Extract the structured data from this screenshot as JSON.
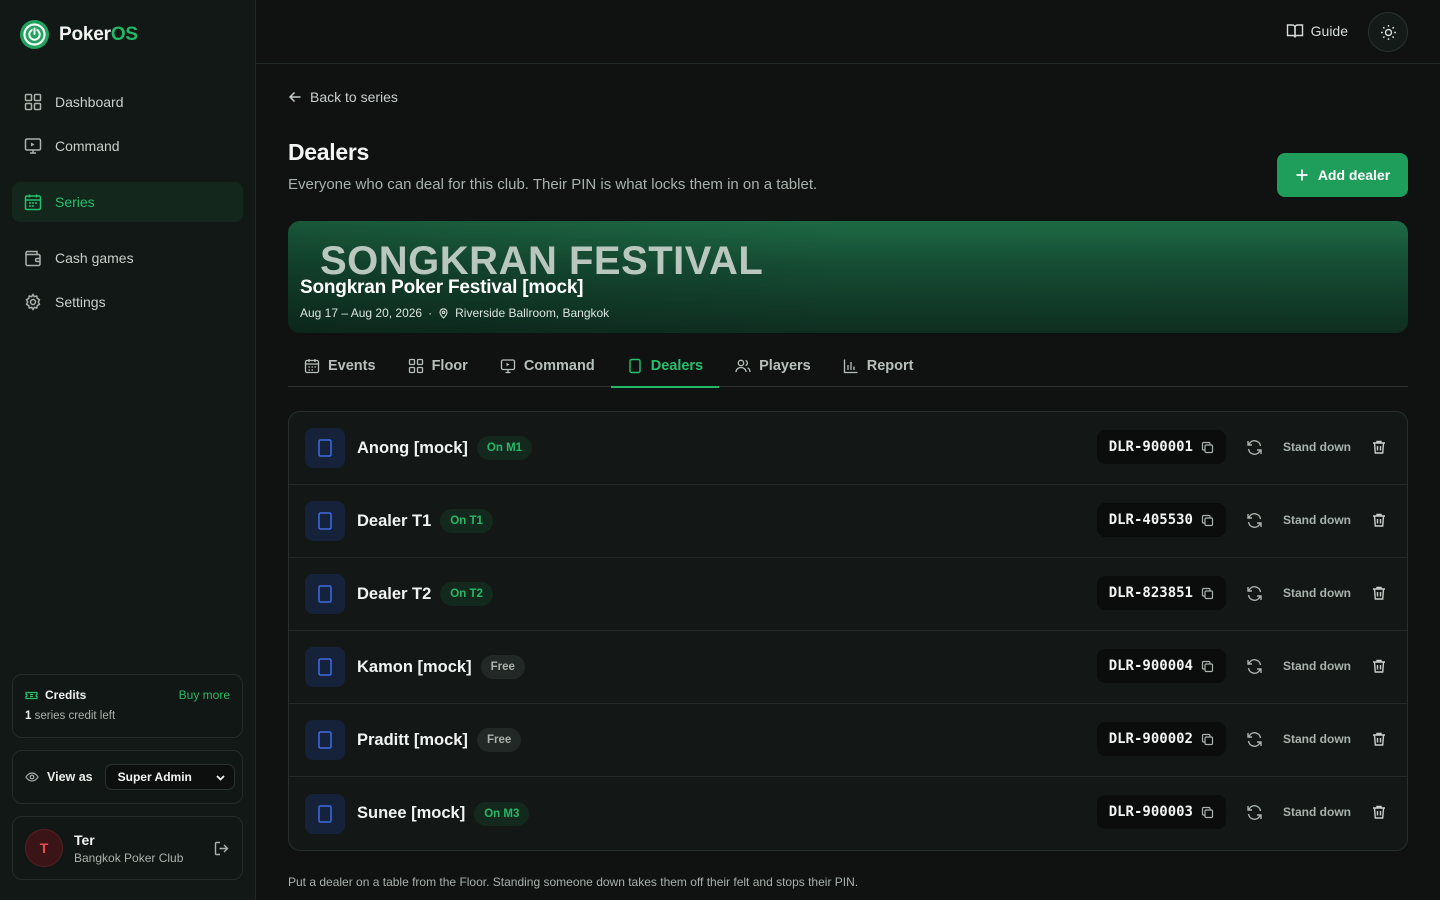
{
  "app": {
    "logo_main": "Poker",
    "logo_accent": "OS"
  },
  "sidebar": {
    "items": [
      {
        "label": "Dashboard",
        "icon": "grid-icon"
      },
      {
        "label": "Command",
        "icon": "monitor-icon"
      },
      {
        "label": "Series",
        "icon": "calendar-icon"
      },
      {
        "label": "Cash games",
        "icon": "wallet-icon"
      },
      {
        "label": "Settings",
        "icon": "gear-icon"
      }
    ],
    "active": "Series",
    "credits": {
      "title": "Credits",
      "buy_more": "Buy more",
      "count": "1",
      "suffix": "series credit left"
    },
    "view_as": {
      "label": "View as",
      "value": "Super Admin"
    },
    "user": {
      "initial": "T",
      "name": "Ter",
      "club": "Bangkok Poker Club"
    }
  },
  "topbar": {
    "guide": "Guide"
  },
  "page": {
    "back": "Back to series",
    "title": "Dealers",
    "subtitle": "Everyone who can deal for this club. Their PIN is what locks them in on a tablet.",
    "add_button": "Add dealer"
  },
  "banner": {
    "big_text": "SONGKRAN FESTIVAL",
    "name": "Songkran Poker Festival [mock]",
    "dates": "Aug 17 – Aug 20, 2026",
    "separator": "·",
    "venue": "Riverside Ballroom, Bangkok"
  },
  "tabs": [
    {
      "label": "Events",
      "icon": "calendar-icon"
    },
    {
      "label": "Floor",
      "icon": "grid-icon"
    },
    {
      "label": "Command",
      "icon": "monitor-icon"
    },
    {
      "label": "Dealers",
      "icon": "tablet-icon"
    },
    {
      "label": "Players",
      "icon": "users-icon"
    },
    {
      "label": "Report",
      "icon": "bar-chart-icon"
    }
  ],
  "active_tab": "Dealers",
  "dealers": [
    {
      "name": "Anong [mock]",
      "status": "On M1",
      "state": "on",
      "pin": "DLR-900001",
      "action": "Stand down"
    },
    {
      "name": "Dealer T1",
      "status": "On T1",
      "state": "on",
      "pin": "DLR-405530",
      "action": "Stand down"
    },
    {
      "name": "Dealer T2",
      "status": "On T2",
      "state": "on",
      "pin": "DLR-823851",
      "action": "Stand down"
    },
    {
      "name": "Kamon [mock]",
      "status": "Free",
      "state": "free",
      "pin": "DLR-900004",
      "action": "Stand down"
    },
    {
      "name": "Praditt [mock]",
      "status": "Free",
      "state": "free",
      "pin": "DLR-900002",
      "action": "Stand down"
    },
    {
      "name": "Sunee [mock]",
      "status": "On M3",
      "state": "on",
      "pin": "DLR-900003",
      "action": "Stand down"
    }
  ],
  "footer_note": "Put a dealer on a table from the Floor. Standing someone down takes them off their felt and stops their PIN.",
  "colors": {
    "accent": "#22b868",
    "button": "#1f9d5a",
    "background": "#0f1211",
    "sidebar": "#121815"
  }
}
